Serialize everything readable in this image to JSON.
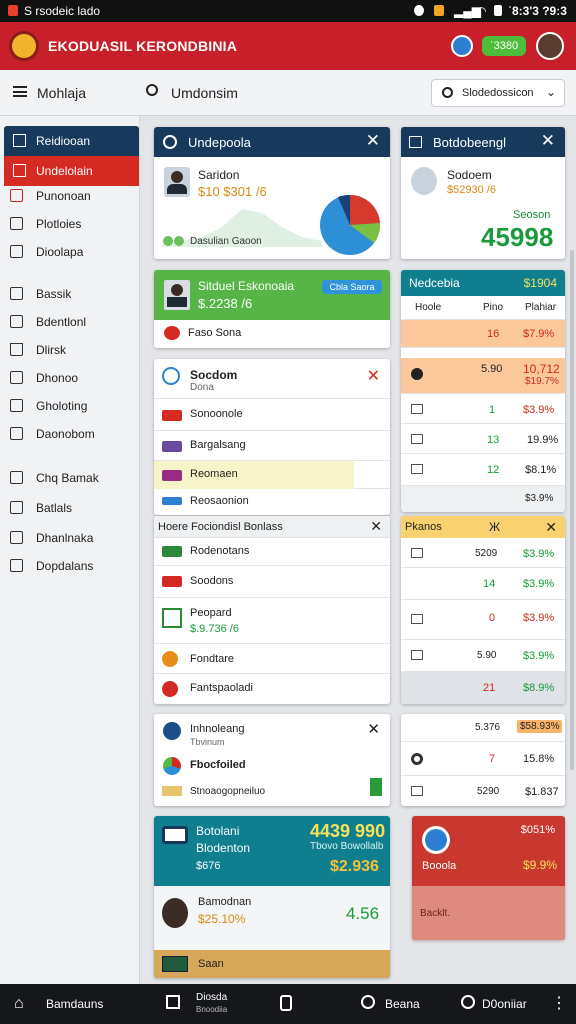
{
  "status_bar": {
    "app_label": "S rsodeic lado",
    "time": "ʿ8:3'3 ?9:3"
  },
  "app_bar": {
    "title": "EKODUASIL KERONDBINIA",
    "badge": "ʿ3380"
  },
  "toolbar": {
    "menu_label": "Mohlaja",
    "search_label": "Umdonsim",
    "dropdown_value": "Slodedossicon"
  },
  "sidebar": {
    "header": "Reidiooan",
    "active": "Undelolain",
    "items": [
      "Punonoan",
      "Plotloies",
      "Dioolapa",
      "Bassik",
      "Bdentlonl",
      "Dlirsk",
      "Dhonoo",
      "Gholoting",
      "Daonobom",
      "Chq Bamak",
      "Batlals",
      "Dhanlnaka",
      "Dopdalans"
    ]
  },
  "col1": {
    "card1": {
      "title": "Undepoola",
      "name": "Saridon",
      "value": "$10 $301 /6",
      "caption": "Dasulian Gaoon"
    },
    "card2": {
      "name": "Sitduel Eskonoaia",
      "value": "$.2238 /6",
      "pill": "Cbla Saora",
      "sub": "Faso Sona"
    },
    "card3": {
      "title": "Socdom",
      "subtitle": "Dona",
      "rows": [
        {
          "label": "Sonoonole"
        },
        {
          "label": "Bargalsang"
        },
        {
          "label": "Reomaen"
        },
        {
          "label": "Reosaonion"
        }
      ]
    },
    "card4": {
      "title": "Hoere Fociondisl Bonlass",
      "rows": [
        {
          "label": "Rodenotans"
        },
        {
          "label": "Soodons"
        },
        {
          "label": "Peopard",
          "value": "$.9.736 /6"
        },
        {
          "label": "Fondtare"
        },
        {
          "label": "Fantspaoladi"
        }
      ]
    },
    "card5": {
      "title": "Inhnoleang",
      "subtitle": "Tbvinum",
      "row1": "Fbocfoiled",
      "row2": "Stnoaogopneiluo"
    },
    "card6": {
      "title": "Botolani",
      "subtitle": "Blodenton",
      "big": "4439 990",
      "sub": "Tbovo Bowollalb",
      "pct": "$676",
      "value2": "$2.936",
      "name": "Bamodnan",
      "pct2": "$25.10%",
      "big2": "4.56",
      "footer": "Saan"
    }
  },
  "col2": {
    "card1": {
      "title": "Botdobeengl",
      "name": "Sodoem",
      "value": "$52930 /6",
      "label": "Seoson",
      "big": "45998"
    },
    "table": {
      "title": "Nedcebia",
      "title_value": "$1904",
      "headers": [
        "Hoole",
        "Pino",
        "Plahiar"
      ],
      "rows": [
        {
          "a": "16",
          "b": "$7.9%"
        },
        {
          "a": "5.90",
          "b": "10,712",
          "c": "$19.7%"
        },
        {
          "a": "1",
          "b": "$3.9%"
        },
        {
          "a": "13",
          "b": "19.9%"
        },
        {
          "a": "12",
          "b": "$8.1%"
        },
        {
          "a": "",
          "b": "$3.9%"
        }
      ]
    },
    "table2": {
      "title": "Pkanos",
      "mark": "Ж",
      "rows": [
        {
          "a": "5209",
          "b": "$3.9%"
        },
        {
          "a": "14",
          "b": "$3.9%"
        },
        {
          "a": "0",
          "b": "$3.9%"
        },
        {
          "a": "5.90",
          "b": "$3.9%"
        },
        {
          "a": "21",
          "b": "$8.9%"
        }
      ]
    },
    "table3": {
      "rows": [
        {
          "a": "5.376",
          "b": "$58.93%"
        },
        {
          "a": "7",
          "b": "15.8%"
        },
        {
          "a": "5290",
          "b": "$1.837"
        }
      ]
    },
    "card2": {
      "pct": "$051%",
      "name": "Booola",
      "value": "$9.9%",
      "link": "Backlt."
    }
  },
  "bottom_nav": {
    "home": "Bamdauns",
    "center": "Diosda",
    "center_sub": "Bnoodiia",
    "right1": "Beana",
    "right2": "D0oniiar"
  }
}
